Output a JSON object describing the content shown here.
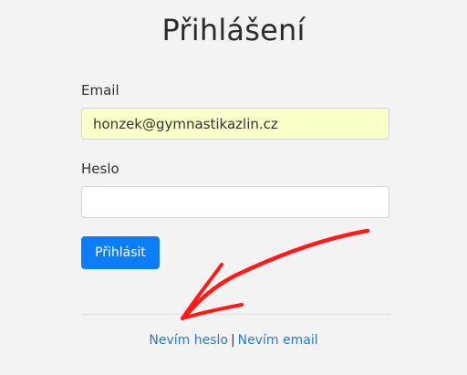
{
  "page": {
    "title": "Přihlášení"
  },
  "form": {
    "email_label": "Email",
    "email_value": "honzek@gymnastikazlin.cz",
    "password_label": "Heslo",
    "password_value": "",
    "submit_label": "Přihlásit"
  },
  "links": {
    "forgot_password": "Nevím heslo",
    "separator": "|",
    "forgot_email": "Nevím email"
  },
  "annotation": {
    "icon": "red-hand-drawn-arrow-icon",
    "color": "#ff0000"
  },
  "colors": {
    "background": "#f3f3f3",
    "primary_button": "#0b7df7",
    "link": "#2e79c6",
    "autofill_background": "#fbffc8"
  }
}
